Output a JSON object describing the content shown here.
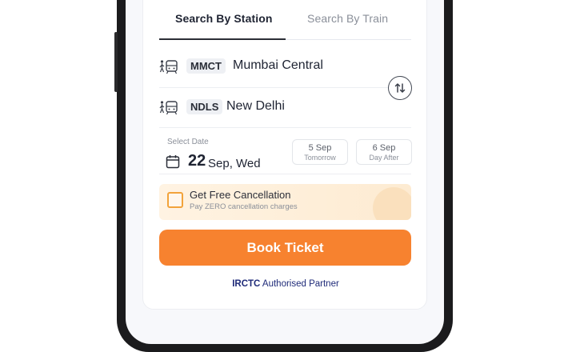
{
  "tabs": [
    {
      "label": "Search By Station",
      "active": true
    },
    {
      "label": "Search By Train",
      "active": false
    }
  ],
  "stations": [
    {
      "code": "MMCT",
      "name": "Mumbai Central",
      "icon": "train-icon"
    },
    {
      "code": "NDLS",
      "name": "New Delhi",
      "icon": "train-icon"
    }
  ],
  "swap": {
    "icon": "swap-vertical-icon"
  },
  "date": {
    "label": "Select Date",
    "day": "22",
    "rest": "Sep, Wed",
    "icon": "calendar-icon",
    "quick_options": [
      {
        "date": "5 Sep",
        "sub": "Tomorrow"
      },
      {
        "date": "6 Sep",
        "sub": "Day After"
      }
    ]
  },
  "cancellation": {
    "title": "Get Free Cancellation",
    "subtitle": "Pay ZERO cancellation charges",
    "checked": false
  },
  "book_button": {
    "label": "Book Ticket",
    "color": "#f7822f"
  },
  "partner": {
    "brand": "IRCTC",
    "text": "Authorised Partner"
  },
  "colors": {
    "accent": "#f7822f",
    "frame_accent": "#2c7ad6",
    "partner_text": "#1e2a78"
  }
}
